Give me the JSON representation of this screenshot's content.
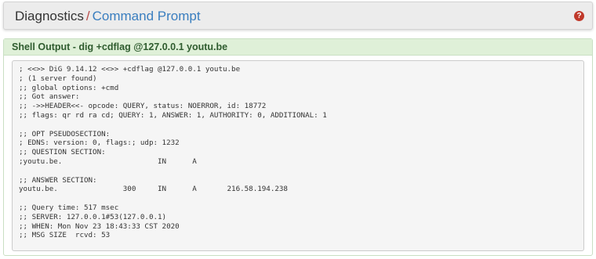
{
  "header": {
    "breadcrumb_root": "Diagnostics",
    "breadcrumb_sep": "/",
    "breadcrumb_current": "Command Prompt",
    "help_icon_glyph": "?"
  },
  "panel": {
    "title": "Shell Output - dig +cdflag @127.0.0.1 youtu.be"
  },
  "output_lines": [
    "; <<>> DiG 9.14.12 <<>> +cdflag @127.0.0.1 youtu.be",
    "; (1 server found)",
    ";; global options: +cmd",
    ";; Got answer:",
    ";; ->>HEADER<<- opcode: QUERY, status: NOERROR, id: 18772",
    ";; flags: qr rd ra cd; QUERY: 1, ANSWER: 1, AUTHORITY: 0, ADDITIONAL: 1",
    "",
    ";; OPT PSEUDOSECTION:",
    "; EDNS: version: 0, flags:; udp: 1232",
    ";; QUESTION SECTION:",
    ";youtu.be.                      IN      A",
    "",
    ";; ANSWER SECTION:",
    "youtu.be.               300     IN      A       216.58.194.238",
    "",
    ";; Query time: 517 msec",
    ";; SERVER: 127.0.0.1#53(127.0.0.1)",
    ";; WHEN: Mon Nov 23 18:43:33 CST 2020",
    ";; MSG SIZE  rcvd: 53"
  ],
  "colors": {
    "header_bg": "#ececec",
    "breadcrumb_link": "#3a7ebf",
    "separator": "#b94a48",
    "help_icon": "#c0392b",
    "panel_heading_bg": "#dff0d8",
    "panel_heading_text": "#2f5c2f",
    "output_bg": "#f5f5f5"
  }
}
